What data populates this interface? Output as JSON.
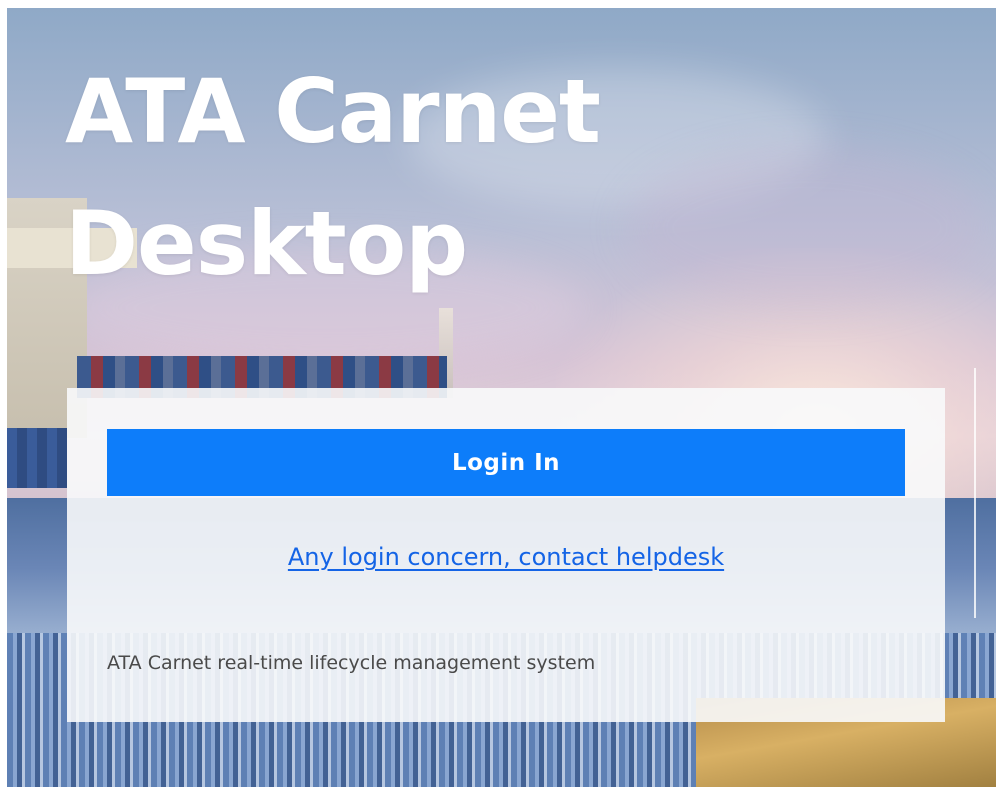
{
  "hero": {
    "title_line1": "ATA Carnet",
    "title_line2": "Desktop"
  },
  "login_panel": {
    "login_button_label": "Login In",
    "help_link_text": "Any login concern, contact helpdesk",
    "tagline": "ATA Carnet real-time lifecycle management system"
  },
  "colors": {
    "accent": "#0d7dfa",
    "link": "#1464e6",
    "panel_background": "#f8f9fb",
    "title_text": "#ffffff"
  }
}
